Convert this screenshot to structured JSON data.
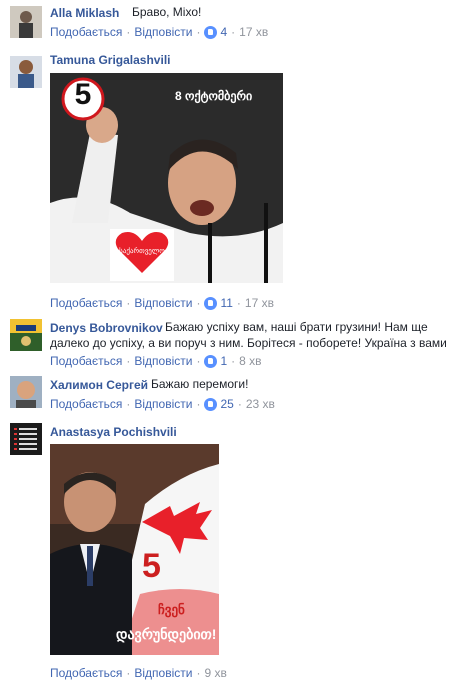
{
  "labels": {
    "like": "Подобається",
    "reply": "Відповісти"
  },
  "comments": [
    {
      "name": "Alla Miklash",
      "text": "Браво, Міхо!",
      "likes": "4",
      "time": "17 хв"
    },
    {
      "name": "Tamuna Grigalashvili",
      "text": "",
      "likes": "11",
      "time": "17 хв",
      "image": {
        "number": "5",
        "date_text": "8 ოქტომბერი",
        "heart_text": "საქართველო"
      }
    },
    {
      "name": "Denys Bobrovnikov",
      "text": "Бажаю успіху вам, наші брати грузини! Нам ще далеко до успіху, а ви поруч з ним. Борітеся - поборете! Україна з вами",
      "likes": "1",
      "time": "8 хв"
    },
    {
      "name": "Халимон Сергей",
      "text": "Бажаю перемоги!",
      "likes": "25",
      "time": "23 хв"
    },
    {
      "name": "Anastasya Pochishvili",
      "text": "",
      "likes": "",
      "time": "9 хв",
      "image": {
        "number": "5",
        "slogan_line1": "ჩვენ",
        "slogan_line2": "დავრუნდებით!"
      }
    }
  ],
  "colors": {
    "link": "#365899",
    "action": "#4267b2",
    "meta": "#90949c",
    "like_badge": "#5890ff",
    "heart": "#e8202a",
    "number_ring": "#d0171d"
  },
  "icons": {
    "like": "thumbs-up-icon"
  }
}
